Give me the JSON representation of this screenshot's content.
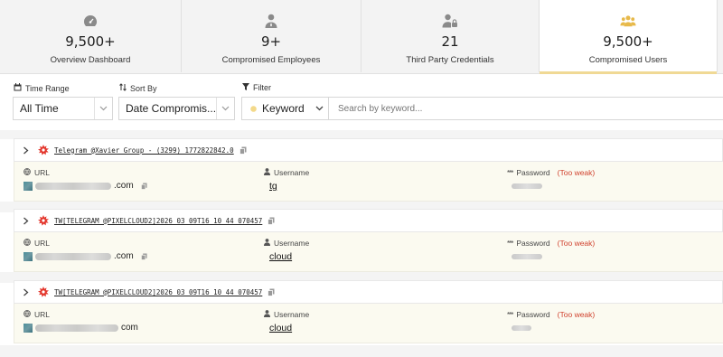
{
  "stats": [
    {
      "value": "9,500+",
      "label": "Overview Dashboard",
      "icon": "gauge-icon"
    },
    {
      "value": "9+",
      "label": "Compromised Employees",
      "icon": "employee-icon"
    },
    {
      "value": "21",
      "label": "Third Party Credentials",
      "icon": "user-lock-icon"
    },
    {
      "value": "9,500+",
      "label": "Compromised Users",
      "icon": "users-group-icon",
      "active": true
    }
  ],
  "filters": {
    "time_range": {
      "label": "Time Range",
      "value": "All Time"
    },
    "sort_by": {
      "label": "Sort By",
      "value": "Date Compromis..."
    },
    "filter": {
      "label": "Filter",
      "value": "Keyword"
    },
    "search_placeholder": "Search by keyword..."
  },
  "columns": {
    "url": "URL",
    "username": "Username",
    "password": "Password",
    "weak": "(Too weak)"
  },
  "records": [
    {
      "title": "Telegram @Xavier Group - (3299) 1772822842.0",
      "url_suffix": ".com",
      "username": "tg"
    },
    {
      "title": "TW[TELEGRAM @PIXELCLOUD2]2026 03 09T16 10 44 070457",
      "url_suffix": ".com",
      "username": "cloud"
    },
    {
      "title": "TW[TELEGRAM @PIXELCLOUD2]2026 03 09T16 10 44 070457",
      "url_suffix": "com",
      "username": "cloud"
    }
  ],
  "colors": {
    "accent": "#f0d995",
    "weak": "#d0412d",
    "virus": "#e3352b"
  }
}
